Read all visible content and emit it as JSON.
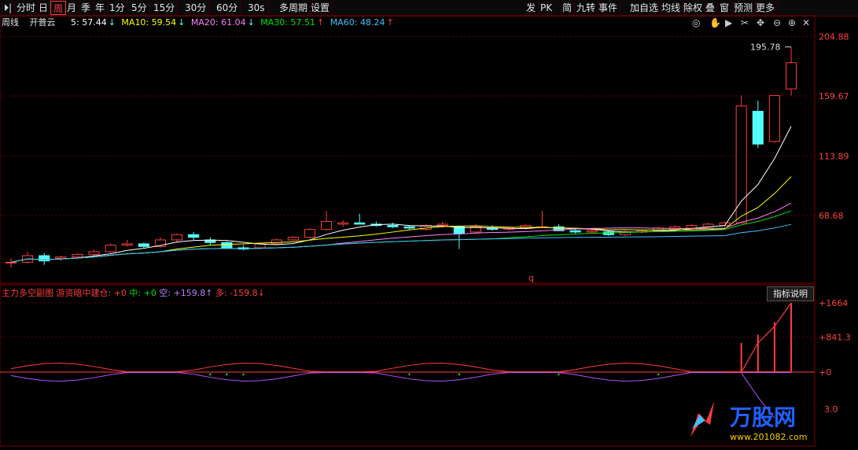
{
  "toolbar": {
    "left_items": [
      "分时",
      "日",
      "周",
      "月",
      "季",
      "年",
      "1分",
      "5分",
      "15分",
      "30分",
      "60分",
      "30s",
      "多周期",
      "设置"
    ],
    "active": "周",
    "right_items": [
      "发",
      "PK",
      "简",
      "九转",
      "事件",
      "加自选",
      "均线",
      "除权",
      "叠",
      "窗",
      "预测",
      "更多"
    ]
  },
  "info": {
    "period": "周线",
    "stock": "开普云",
    "ma5": "5: 57.44",
    "ma10": "MA10: 59.54",
    "ma20": "MA20: 61.04",
    "ma30": "MA30: 57.51",
    "ma60": "MA60: 48.24",
    "ma5_arrow": "↓",
    "ma10_arrow": "↓",
    "ma20_arrow": "↓",
    "ma30_arrow": "↑",
    "ma60_arrow": "↑"
  },
  "price_axis": [
    "204.88",
    "159.67",
    "113.89",
    "68.68"
  ],
  "max_label": "195.78",
  "marker": "q",
  "indicator": {
    "title": "主力多空副图",
    "sub": "游资暗中建仓: +0",
    "zhong": "中: +0",
    "kong": "空: +159.8↑",
    "duo": "多: -159.8↓",
    "button": "指标说明",
    "axis": [
      "+1664",
      "+841.3",
      "+0",
      "3.0"
    ]
  },
  "colors": {
    "up": "#ff3c3c",
    "down": "#54ffff",
    "ma5": "#ffffff",
    "ma10": "#ffff00",
    "ma20": "#ff80ff",
    "ma30": "#00e000",
    "ma60": "#40c0ff"
  },
  "watermark": {
    "brand": "万股网",
    "url": "www.201082.com"
  },
  "chart_data": {
    "type": "candlestick",
    "ylim": [
      20,
      210
    ],
    "candles": [
      [
        33,
        36,
        29,
        33
      ],
      [
        33,
        41,
        32,
        38
      ],
      [
        38,
        40,
        31,
        34
      ],
      [
        36,
        38,
        34,
        37
      ],
      [
        37,
        40,
        35,
        39
      ],
      [
        39,
        43,
        38,
        41
      ],
      [
        41,
        47,
        40,
        46
      ],
      [
        46,
        50,
        45,
        47
      ],
      [
        47,
        48,
        44,
        45
      ],
      [
        45,
        52,
        44,
        50
      ],
      [
        50,
        55,
        48,
        54
      ],
      [
        54,
        56,
        50,
        52
      ],
      [
        50,
        52,
        46,
        48
      ],
      [
        48,
        49,
        43,
        44
      ],
      [
        44,
        46,
        42,
        43
      ],
      [
        44,
        48,
        43,
        47
      ],
      [
        47,
        51,
        46,
        50
      ],
      [
        50,
        53,
        49,
        52
      ],
      [
        52,
        59,
        51,
        58
      ],
      [
        58,
        72,
        57,
        64
      ],
      [
        62,
        65,
        60,
        63
      ],
      [
        63,
        70,
        62,
        62
      ],
      [
        62,
        64,
        60,
        61
      ],
      [
        61,
        63,
        59,
        60
      ],
      [
        60,
        61,
        58,
        59
      ],
      [
        58,
        62,
        57,
        61
      ],
      [
        61,
        64,
        59,
        62
      ],
      [
        60,
        61,
        43,
        55
      ],
      [
        56,
        62,
        55,
        60
      ],
      [
        59,
        61,
        57,
        58
      ],
      [
        58,
        60,
        57,
        59
      ],
      [
        59,
        62,
        58,
        61
      ],
      [
        60,
        72,
        59,
        60
      ],
      [
        60,
        62,
        57,
        57
      ],
      [
        57,
        59,
        55,
        56
      ],
      [
        56,
        58,
        55,
        57
      ],
      [
        56,
        57,
        53,
        54
      ],
      [
        54,
        57,
        53,
        56
      ],
      [
        56,
        58,
        55,
        57
      ],
      [
        57,
        60,
        56,
        59
      ],
      [
        58,
        61,
        57,
        60
      ],
      [
        59,
        62,
        58,
        61
      ],
      [
        60,
        63,
        59,
        62
      ],
      [
        61,
        64,
        60,
        63
      ],
      [
        63,
        160,
        63,
        152
      ],
      [
        148,
        156,
        120,
        123
      ],
      [
        125,
        160,
        124,
        160
      ],
      [
        165,
        197,
        160,
        185
      ]
    ],
    "indicator_series": {
      "red": "positive line",
      "purple": "negative line"
    }
  }
}
